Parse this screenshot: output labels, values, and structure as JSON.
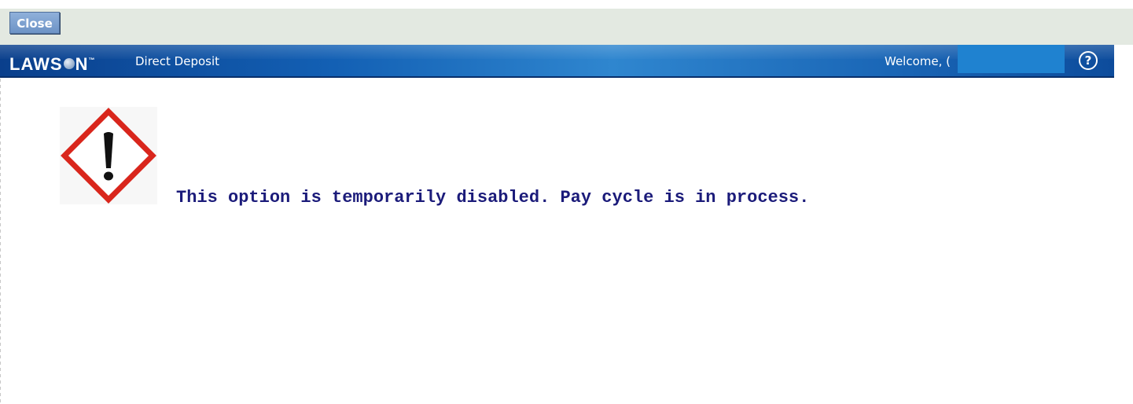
{
  "toolbar": {
    "close_label": "Close"
  },
  "banner": {
    "logo_text_left": "LAWS",
    "logo_text_right": "N",
    "logo_trademark": "™",
    "app_title": "Direct Deposit",
    "welcome_text": "Welcome, (",
    "help_label": "?"
  },
  "content": {
    "warning_icon": "hazard-exclamation-icon",
    "message": "This option is temporarily disabled. Pay cycle is in process."
  },
  "colors": {
    "toolbar_bg": "#e3e9e1",
    "banner_blue": "#1360b4",
    "message_text": "#1b1b7a",
    "hazard_red": "#d9261c"
  }
}
